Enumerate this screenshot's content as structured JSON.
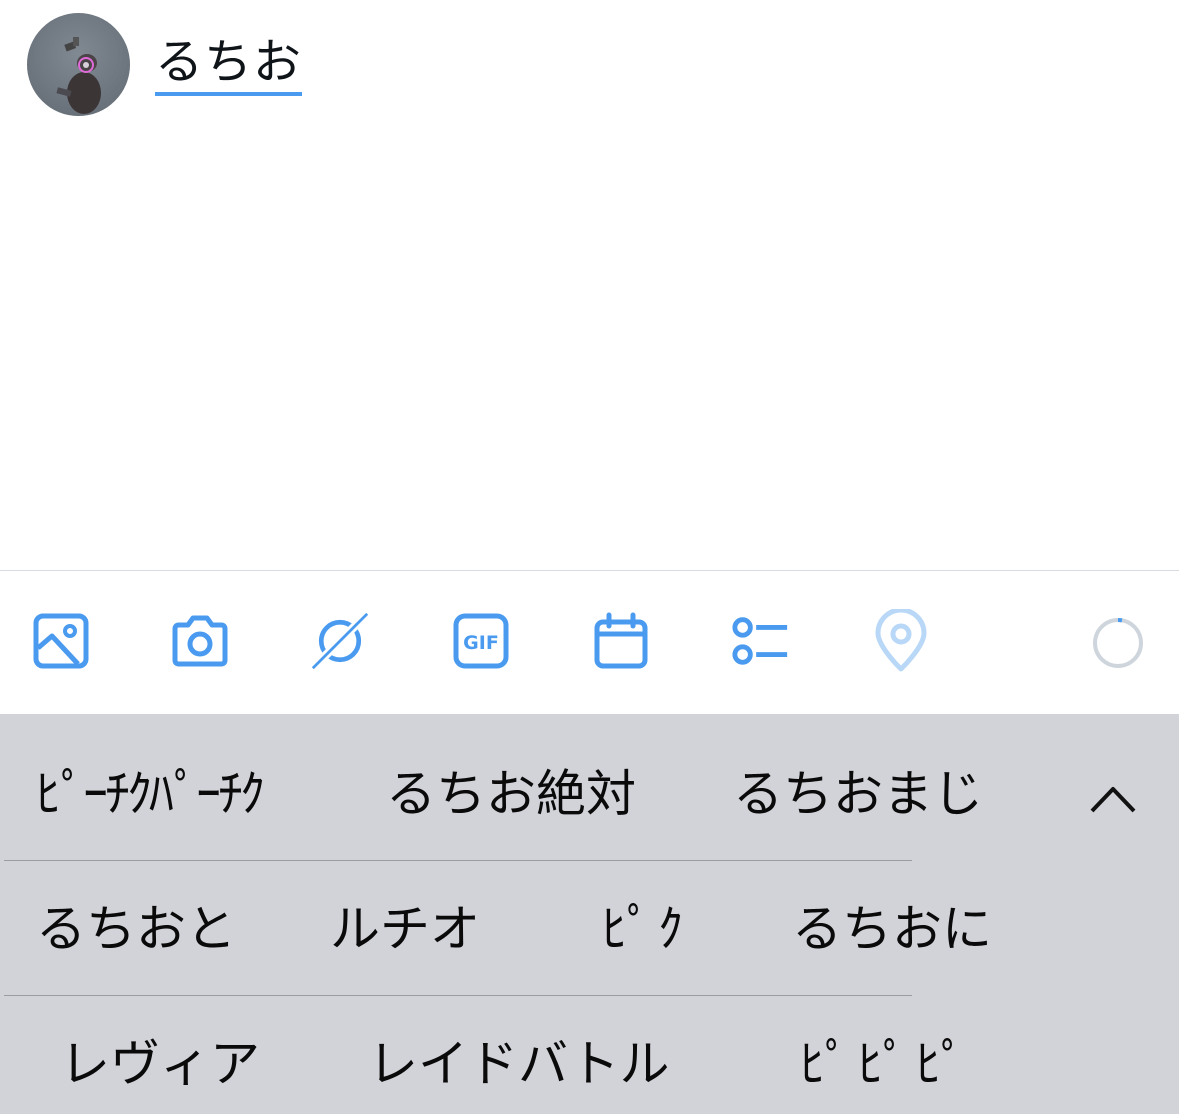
{
  "compose": {
    "tweet_text": "るちお",
    "avatar": "avatar-photo"
  },
  "toolbar": {
    "icons": [
      "image-icon",
      "camera-icon",
      "sparkle-icon",
      "gif-icon",
      "calendar-icon",
      "list-icon",
      "location-icon"
    ],
    "gif_label": "GIF",
    "accent_color": "#4a9bf0",
    "location_color": "#b9d8f7",
    "counter_color": "#cfd5dc"
  },
  "keyboard": {
    "background": "#d1d3d9",
    "rows": [
      [
        "ﾋﾟｰﾁｸﾊﾟｰﾁｸ",
        "るちお絶対",
        "るちおまじ"
      ],
      [
        "るちおと",
        "ルチオ",
        "ﾋﾟｸ",
        "るちおに"
      ],
      [
        "レヴィア",
        "レイドバトル",
        "ﾋﾟﾋﾟﾋﾟ"
      ]
    ],
    "collapse_icon": "chevron-up-icon"
  }
}
